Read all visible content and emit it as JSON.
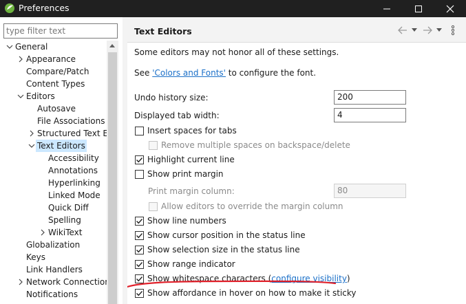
{
  "window": {
    "title": "Preferences",
    "controls": {
      "minimize": "minimize-icon",
      "maximize": "maximize-icon",
      "close": "close-icon"
    }
  },
  "sidebar": {
    "filter_placeholder": "type filter text",
    "tree": [
      {
        "label": "General",
        "level": 0,
        "state": "expanded"
      },
      {
        "label": "Appearance",
        "level": 1,
        "state": "collapsed"
      },
      {
        "label": "Compare/Patch",
        "level": 1,
        "state": "leaf"
      },
      {
        "label": "Content Types",
        "level": 1,
        "state": "leaf"
      },
      {
        "label": "Editors",
        "level": 1,
        "state": "expanded"
      },
      {
        "label": "Autosave",
        "level": 2,
        "state": "leaf"
      },
      {
        "label": "File Associations",
        "level": 2,
        "state": "leaf"
      },
      {
        "label": "Structured Text Ec",
        "level": 2,
        "state": "collapsed"
      },
      {
        "label": "Text Editors",
        "level": 2,
        "state": "expanded",
        "selected": true
      },
      {
        "label": "Accessibility",
        "level": 3,
        "state": "leaf"
      },
      {
        "label": "Annotations",
        "level": 3,
        "state": "leaf"
      },
      {
        "label": "Hyperlinking",
        "level": 3,
        "state": "leaf"
      },
      {
        "label": "Linked Mode",
        "level": 3,
        "state": "leaf"
      },
      {
        "label": "Quick Diff",
        "level": 3,
        "state": "leaf"
      },
      {
        "label": "Spelling",
        "level": 3,
        "state": "leaf"
      },
      {
        "label": "WikiText",
        "level": 3,
        "state": "collapsed"
      },
      {
        "label": "Globalization",
        "level": 1,
        "state": "leaf"
      },
      {
        "label": "Keys",
        "level": 1,
        "state": "leaf"
      },
      {
        "label": "Link Handlers",
        "level": 1,
        "state": "leaf"
      },
      {
        "label": "Network Connection",
        "level": 1,
        "state": "collapsed"
      },
      {
        "label": "Notifications",
        "level": 1,
        "state": "leaf"
      }
    ]
  },
  "page": {
    "title": "Text Editors",
    "intro": "Some editors may not honor all of these settings.",
    "see_prefix": "See ",
    "see_link": "'Colors and Fonts'",
    "see_suffix": " to configure the font.",
    "undo_label": "Undo history size:",
    "undo_value": "200",
    "tab_width_label": "Displayed tab width:",
    "tab_width_value": "4",
    "print_margin_label": "Print margin column:",
    "print_margin_value": "80",
    "options": [
      {
        "label": "Insert spaces for tabs",
        "checked": false,
        "enabled": true,
        "indent": 0
      },
      {
        "label": "Remove multiple spaces on backspace/delete",
        "checked": false,
        "enabled": false,
        "indent": 1
      },
      {
        "label": "Highlight current line",
        "checked": true,
        "enabled": true,
        "indent": 0
      },
      {
        "label": "Show print margin",
        "checked": false,
        "enabled": true,
        "indent": 0
      },
      {
        "label": "Allow editors to override the margin column",
        "checked": false,
        "enabled": false,
        "indent": 1
      },
      {
        "label": "Show line numbers",
        "checked": true,
        "enabled": true,
        "indent": 0
      },
      {
        "label": "Show cursor position in the status line",
        "checked": true,
        "enabled": true,
        "indent": 0
      },
      {
        "label": "Show selection size in the status line",
        "checked": true,
        "enabled": true,
        "indent": 0
      },
      {
        "label": "Show range indicator",
        "checked": true,
        "enabled": true,
        "indent": 0
      },
      {
        "label": "Show whitespace characters",
        "checked": true,
        "enabled": true,
        "indent": 0,
        "link_prefix": " (",
        "link": "configure visibility",
        "link_suffix": ")"
      },
      {
        "label": "Show affordance in hover on how to make it sticky",
        "checked": true,
        "enabled": true,
        "indent": 0
      }
    ]
  },
  "colors": {
    "titlebar": "#202020",
    "selection": "#cce8ff",
    "link": "#1a6fc8",
    "annotation": "#e0202a"
  }
}
